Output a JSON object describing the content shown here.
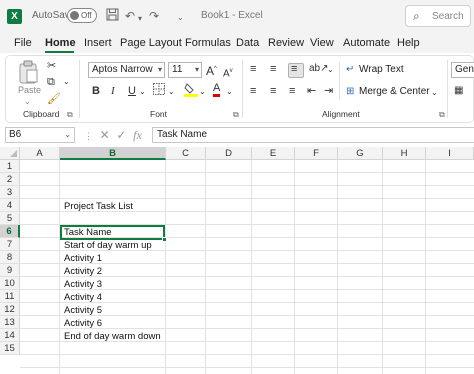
{
  "titlebar": {
    "logo": "X",
    "autosave_label": "AutoSave",
    "autosave_state": "Off",
    "save_icon": "save-icon",
    "undo_icon": "undo-icon",
    "redo_icon": "redo-icon",
    "customize_icon": "chevron-down-icon",
    "doc_title": "Book1  -  Excel",
    "search_placeholder": "Search"
  },
  "menu": {
    "tabs": [
      {
        "label": "File"
      },
      {
        "label": "Home"
      },
      {
        "label": "Insert"
      },
      {
        "label": "Page Layout"
      },
      {
        "label": "Formulas"
      },
      {
        "label": "Data"
      },
      {
        "label": "Review"
      },
      {
        "label": "View"
      },
      {
        "label": "Automate"
      },
      {
        "label": "Help"
      }
    ],
    "active": "Home",
    "accent": "#107c41"
  },
  "ribbon": {
    "clipboard": {
      "paste_label": "Paste",
      "group_label": "Clipboard"
    },
    "font": {
      "font_name": "Aptos Narrow",
      "font_size": "11",
      "grow_icon": "A",
      "shrink_icon": "A",
      "bold": "B",
      "italic": "I",
      "underline": "U",
      "font_color_letter": "A",
      "group_label": "Font",
      "fill_color": "#ffff00",
      "font_color": "#e00000"
    },
    "alignment": {
      "wrap_text": "Wrap Text",
      "merge_center": "Merge & Center",
      "group_label": "Alignment"
    },
    "number": {
      "format": "Gener"
    }
  },
  "formula_bar": {
    "cell_ref": "B6",
    "fx": "fx",
    "content": "Task Name"
  },
  "grid": {
    "columns": [
      "A",
      "B",
      "C",
      "D",
      "E",
      "F",
      "G",
      "H",
      "I"
    ],
    "rows": [
      "1",
      "2",
      "3",
      "4",
      "5",
      "6",
      "7",
      "8",
      "9",
      "10",
      "11",
      "12",
      "13",
      "14",
      "15"
    ],
    "selected_col": "B",
    "selected_row": "6",
    "cells": [
      {
        "row": "4",
        "text": "Project Task List"
      },
      {
        "row": "6",
        "text": "Task Name"
      },
      {
        "row": "7",
        "text": "Start of day warm up"
      },
      {
        "row": "8",
        "text": "Activity 1"
      },
      {
        "row": "9",
        "text": "Activity 2"
      },
      {
        "row": "10",
        "text": "Activity 3"
      },
      {
        "row": "11",
        "text": "Activity 4"
      },
      {
        "row": "12",
        "text": "Activity 5"
      },
      {
        "row": "13",
        "text": "Activity 6"
      },
      {
        "row": "14",
        "text": "End of day warm down"
      }
    ]
  }
}
